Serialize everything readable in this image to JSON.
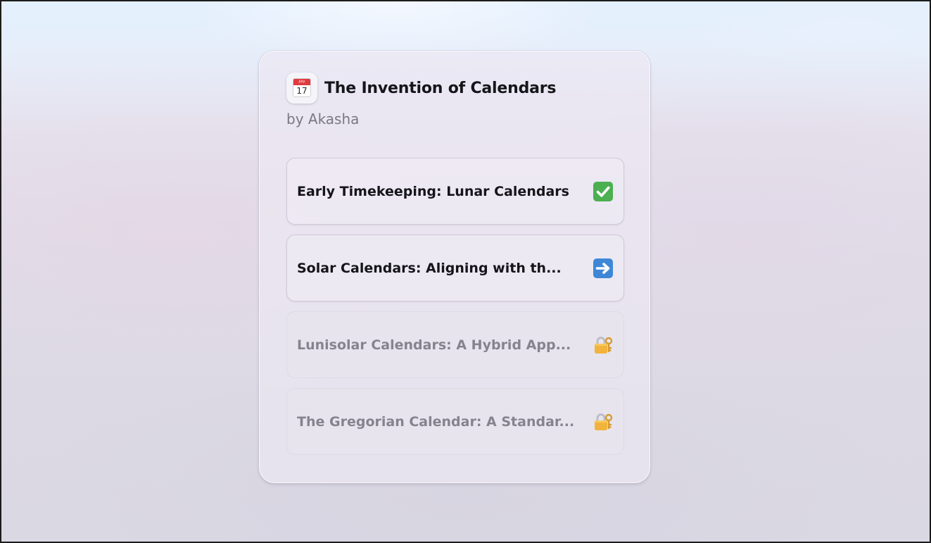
{
  "course": {
    "title": "The Invention of Calendars",
    "author": "by Akasha",
    "icon": "calendar-icon",
    "icon_month": "July",
    "icon_day": "17"
  },
  "chapters": [
    {
      "label": "Early Timekeeping: Lunar Calendars",
      "status": "completed",
      "icon": "check-mark-icon"
    },
    {
      "label": "Solar Calendars: Aligning with th...",
      "status": "current",
      "icon": "right-arrow-icon"
    },
    {
      "label": "Lunisolar Calendars: A Hybrid App...",
      "status": "locked",
      "icon": "lock-with-key-icon"
    },
    {
      "label": "The Gregorian Calendar: A Standar...",
      "status": "locked",
      "icon": "lock-with-key-icon"
    }
  ],
  "colors": {
    "check": "#4caf50",
    "arrow": "#3f87d6",
    "lock": "#f2b33d"
  }
}
